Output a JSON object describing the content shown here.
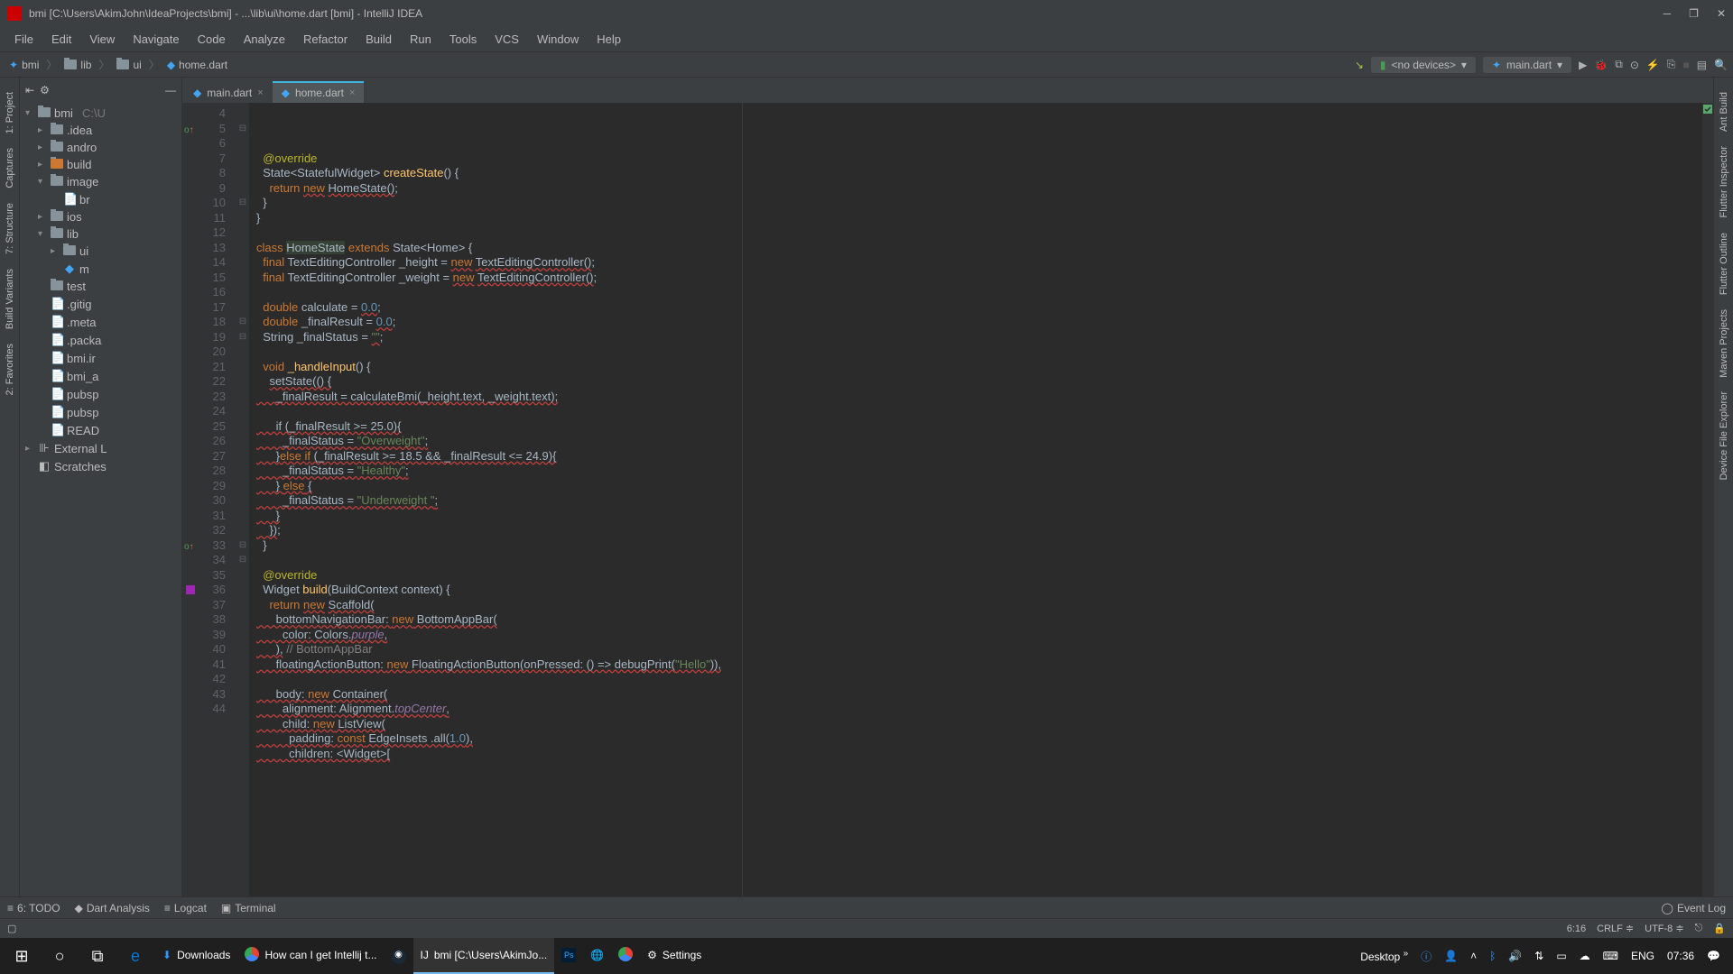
{
  "title": "bmi [C:\\Users\\AkimJohn\\IdeaProjects\\bmi] - ...\\lib\\ui\\home.dart [bmi] - IntelliJ IDEA",
  "menu": [
    "File",
    "Edit",
    "View",
    "Navigate",
    "Code",
    "Analyze",
    "Refactor",
    "Build",
    "Run",
    "Tools",
    "VCS",
    "Window",
    "Help"
  ],
  "breadcrumbs": [
    "bmi",
    "lib",
    "ui",
    "home.dart"
  ],
  "devices": {
    "label": "<no devices>"
  },
  "run_config": {
    "label": "main.dart"
  },
  "tabs": [
    {
      "name": "main.dart",
      "active": false
    },
    {
      "name": "home.dart",
      "active": true
    }
  ],
  "project_tree": [
    {
      "indent": 0,
      "arrow": "▾",
      "icon": "folder",
      "label": "bmi",
      "suffix": "C:\\U"
    },
    {
      "indent": 1,
      "arrow": "▸",
      "icon": "folder",
      "label": ".idea"
    },
    {
      "indent": 1,
      "arrow": "▸",
      "icon": "folder",
      "label": "andro"
    },
    {
      "indent": 1,
      "arrow": "▸",
      "icon": "folder-orange",
      "label": "build"
    },
    {
      "indent": 1,
      "arrow": "▾",
      "icon": "folder",
      "label": "image"
    },
    {
      "indent": 2,
      "arrow": " ",
      "icon": "file",
      "label": "br"
    },
    {
      "indent": 1,
      "arrow": "▸",
      "icon": "folder",
      "label": "ios"
    },
    {
      "indent": 1,
      "arrow": "▾",
      "icon": "folder",
      "label": "lib"
    },
    {
      "indent": 2,
      "arrow": "▸",
      "icon": "folder",
      "label": "ui"
    },
    {
      "indent": 2,
      "arrow": " ",
      "icon": "dart",
      "label": "m"
    },
    {
      "indent": 1,
      "arrow": " ",
      "icon": "folder",
      "label": "test"
    },
    {
      "indent": 1,
      "arrow": " ",
      "icon": "file",
      "label": ".gitig"
    },
    {
      "indent": 1,
      "arrow": " ",
      "icon": "file",
      "label": ".meta"
    },
    {
      "indent": 1,
      "arrow": " ",
      "icon": "file",
      "label": ".packa"
    },
    {
      "indent": 1,
      "arrow": " ",
      "icon": "file",
      "label": "bmi.ir"
    },
    {
      "indent": 1,
      "arrow": " ",
      "icon": "file",
      "label": "bmi_a"
    },
    {
      "indent": 1,
      "arrow": " ",
      "icon": "file",
      "label": "pubsp"
    },
    {
      "indent": 1,
      "arrow": " ",
      "icon": "file",
      "label": "pubsp"
    },
    {
      "indent": 1,
      "arrow": " ",
      "icon": "file",
      "label": "READ"
    },
    {
      "indent": 0,
      "arrow": "▸",
      "icon": "lib",
      "label": "External L"
    },
    {
      "indent": 0,
      "arrow": " ",
      "icon": "scratch",
      "label": "Scratches"
    }
  ],
  "gutter_start": 4,
  "code": [
    {
      "n": 4,
      "html": "  <span class='ann'>@override</span>"
    },
    {
      "n": 5,
      "html": "  <span class='cls'>State&lt;StatefulWidget&gt;</span> <span class='fn'>createState</span>() {",
      "mark": "oi"
    },
    {
      "n": 6,
      "html": "    <span class='kw'>return</span> <span class='kw err'>new</span> <span class='err'>HomeState()</span>;"
    },
    {
      "n": 7,
      "html": "  }"
    },
    {
      "n": 8,
      "html": "}"
    },
    {
      "n": 9,
      "html": ""
    },
    {
      "n": 10,
      "html": "<span class='kw'>class</span> <span class='bg-hl'>HomeState</span> <span class='kw'>extends</span> State&lt;Home&gt; {"
    },
    {
      "n": 11,
      "html": "  <span class='kw'>final</span> TextEditingController _height = <span class='kw err'>new</span> <span class='err'>TextEditingController()</span>;"
    },
    {
      "n": 12,
      "html": "  <span class='kw'>final</span> TextEditingController _weight = <span class='kw err'>new</span> <span class='err'>TextEditingController()</span>;"
    },
    {
      "n": 13,
      "html": ""
    },
    {
      "n": 14,
      "html": "  <span class='kw'>double</span> calculate = <span class='num err'>0.0</span>;"
    },
    {
      "n": 15,
      "html": "  <span class='kw'>double</span> _finalResult = <span class='num err'>0.0</span>;"
    },
    {
      "n": 16,
      "html": "  String _finalStatus = <span class='str err'>\"\"</span>;"
    },
    {
      "n": 17,
      "html": ""
    },
    {
      "n": 18,
      "html": "  <span class='kw'>void</span> <span class='fn'>_handleInput</span>() {"
    },
    {
      "n": 19,
      "html": "    <span class='err'>setState(() {</span>"
    },
    {
      "n": 20,
      "html": "<span class='err'>      _finalResult = calculateBmi(_height.text, _weight.text);</span>"
    },
    {
      "n": 21,
      "html": "<span class='err'></span>"
    },
    {
      "n": 22,
      "html": "<span class='err'>      if (_finalResult >= 25.0){</span>"
    },
    {
      "n": 23,
      "html": "<span class='err'>        _finalStatus = </span><span class='str err'>\"Overweight\"</span><span class='err'>;</span>"
    },
    {
      "n": 24,
      "html": "<span class='err'>      }</span><span class='kw err'>else if</span><span class='err'> (_finalResult >= 18.5 && _finalResult <= 24.9){</span>"
    },
    {
      "n": 25,
      "html": "<span class='err'>        _finalStatus = </span><span class='str err'>\"Healthy\"</span><span class='err'>;</span>"
    },
    {
      "n": 26,
      "html": "<span class='err'>      } </span><span class='kw err'>else</span><span class='err'> {</span>"
    },
    {
      "n": 27,
      "html": "<span class='err'>        _finalStatus = </span><span class='str err'>\"Underweight \"</span><span class='err'>;</span>"
    },
    {
      "n": 28,
      "html": "<span class='err'>      }</span>"
    },
    {
      "n": 29,
      "html": "<span class='err'>    })</span>;"
    },
    {
      "n": 30,
      "html": "  }"
    },
    {
      "n": 31,
      "html": ""
    },
    {
      "n": 32,
      "html": "  <span class='ann'>@override</span>"
    },
    {
      "n": 33,
      "html": "  Widget <span class='fn'>build</span>(BuildContext context) {",
      "mark": "oi"
    },
    {
      "n": 34,
      "html": "    <span class='kw'>return</span> <span class='kw err'>new</span> <span class='err'>Scaffold(</span>"
    },
    {
      "n": 35,
      "html": "<span class='err'>      bottomNavigationBar: </span><span class='kw err'>new</span><span class='err'> BottomAppBar(</span>"
    },
    {
      "n": 36,
      "html": "<span class='err'>        color: Colors.</span><span class='purple err'>purple</span><span class='err'>,</span>",
      "mark": "purple"
    },
    {
      "n": 37,
      "html": "<span class='err'>      ),</span> <span class='cmt'>// BottomAppBar</span>"
    },
    {
      "n": 38,
      "html": "<span class='err'>      floatingActionButton: </span><span class='kw err'>new</span><span class='err'> FloatingActionButton(onPressed: () => debugPrint(</span><span class='str err'>\"Hello\"</span><span class='err'>)),</span>"
    },
    {
      "n": 39,
      "html": "<span class='err'></span>"
    },
    {
      "n": 40,
      "html": "<span class='err'>      body: </span><span class='kw err'>new</span><span class='err'> Container(</span>"
    },
    {
      "n": 41,
      "html": "<span class='err'>        alignment: Alignment.</span><span class='purple err'>topCenter</span><span class='err'>,</span>"
    },
    {
      "n": 42,
      "html": "<span class='err'>        child: </span><span class='kw err'>new</span><span class='err'> ListView(</span>"
    },
    {
      "n": 43,
      "html": "<span class='err'>          padding: </span><span class='kw err'>const</span><span class='err'> EdgeInsets .all(</span><span class='num err'>1.0</span><span class='err'>),</span>"
    },
    {
      "n": 44,
      "html": "<span class='err'>          children: &lt;Widget&gt;[</span>"
    }
  ],
  "left_tabs": [
    "1: Project",
    "Captures",
    "7: Structure",
    "Build Variants",
    "2: Favorites"
  ],
  "right_tabs": [
    "Ant Build",
    "Flutter Inspector",
    "Flutter Outline",
    "Maven Projects",
    "Device File Explorer"
  ],
  "bottom_tabs": [
    "6: TODO",
    "Dart Analysis",
    "Logcat",
    "Terminal"
  ],
  "event_log": "Event Log",
  "status": {
    "pos": "6:16",
    "sep": "CRLF",
    "enc": "UTF-8"
  },
  "taskbar": {
    "items": [
      {
        "icon": "⬇",
        "label": "Downloads",
        "color": "#3794ff"
      },
      {
        "icon": "●",
        "label": "How can I get Intellij t...",
        "color": "#e8453c",
        "chrome": true
      },
      {
        "icon": "▶",
        "label": "",
        "steam": true
      },
      {
        "icon": "IJ",
        "label": "bmi [C:\\Users\\AkimJo...",
        "active": true
      },
      {
        "icon": "Ps",
        "label": "",
        "ps": true
      },
      {
        "icon": "🌐",
        "label": "",
        "globe": true
      },
      {
        "icon": "●",
        "label": "",
        "chrome": true
      },
      {
        "icon": "⚙",
        "label": "Settings"
      }
    ],
    "desktop": "Desktop",
    "lang": "ENG",
    "time": "07:36"
  }
}
